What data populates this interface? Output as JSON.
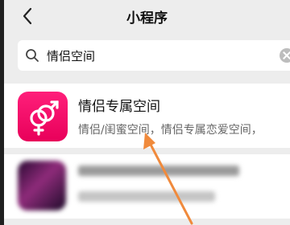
{
  "header": {
    "title": "小程序",
    "back_icon": "chevron-left-icon"
  },
  "search": {
    "query": "情侣空间",
    "search_icon": "search-icon",
    "clear_icon": "clear-icon"
  },
  "results": [
    {
      "name": "情侣专属空间",
      "description": "情侣/闺蜜空间，情侣专属恋爱空间，",
      "icon": "gender-symbols-icon",
      "icon_color": "#f5146b"
    }
  ],
  "annotation": {
    "arrow_color": "#f08a3c"
  }
}
